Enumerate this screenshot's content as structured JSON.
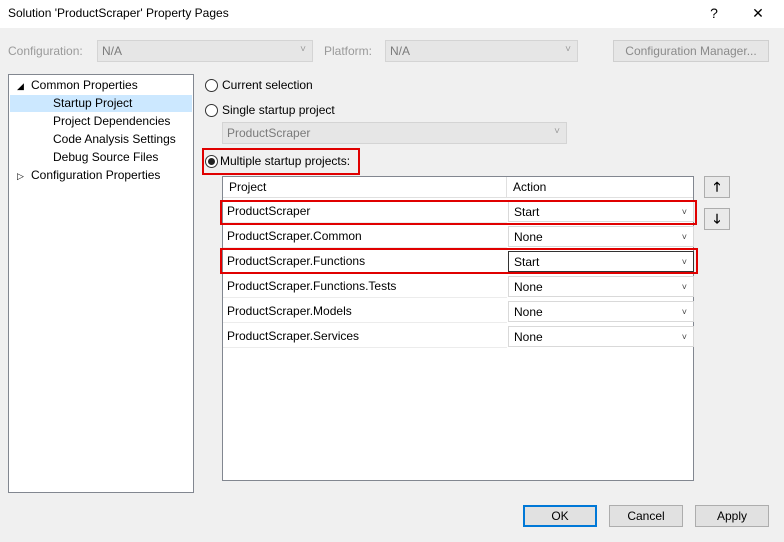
{
  "window": {
    "title": "Solution 'ProductScraper' Property Pages",
    "help": "?",
    "close": "✕"
  },
  "config": {
    "label": "Configuration:",
    "value": "N/A"
  },
  "platform": {
    "label": "Platform:",
    "value": "N/A"
  },
  "config_manager_label": "Configuration Manager...",
  "tree": {
    "common": {
      "expander": "◢",
      "label": "Common Properties"
    },
    "items": [
      "Startup Project",
      "Project Dependencies",
      "Code Analysis Settings",
      "Debug Source Files"
    ],
    "config_props": {
      "expander": "▷",
      "label": "Configuration Properties"
    }
  },
  "options": {
    "current": "Current selection",
    "single": "Single startup project",
    "single_value": "ProductScraper",
    "multiple": "Multiple startup projects:"
  },
  "grid": {
    "headers": {
      "project": "Project",
      "action": "Action"
    },
    "rows": [
      {
        "project": "ProductScraper",
        "action": "Start"
      },
      {
        "project": "ProductScraper.Common",
        "action": "None"
      },
      {
        "project": "ProductScraper.Functions",
        "action": "Start"
      },
      {
        "project": "ProductScraper.Functions.Tests",
        "action": "None"
      },
      {
        "project": "ProductScraper.Models",
        "action": "None"
      },
      {
        "project": "ProductScraper.Services",
        "action": "None"
      }
    ]
  },
  "move": {
    "up": "🡑",
    "down": "🡓"
  },
  "buttons": {
    "ok": "OK",
    "cancel": "Cancel",
    "apply": "Apply"
  },
  "icons": {
    "chevron": "˅"
  }
}
